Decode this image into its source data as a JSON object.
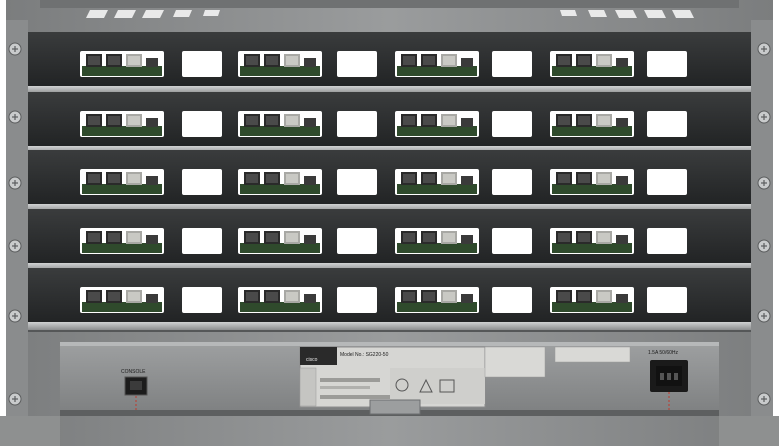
{
  "scene": {
    "subject": "rack-mounted cluster",
    "shelf_count": 5,
    "boards_per_shelf": 4
  },
  "colors": {
    "frame": "#8e9090",
    "frame_dark": "#5e6061",
    "interior": "#2b2d2e",
    "shelf": "#b9bbbc",
    "window": "#ffffff",
    "pcb": "#2f4a2c",
    "port_metal": "#c9c9c4",
    "label": "#d6d6d3",
    "power_socket": "#1a1a1a"
  },
  "switch_panel": {
    "console_label": "CONSOLE",
    "model_label": "Model No.: SG220-50",
    "brand": "cisco",
    "power_label": "1.5A 50/60Hz"
  }
}
